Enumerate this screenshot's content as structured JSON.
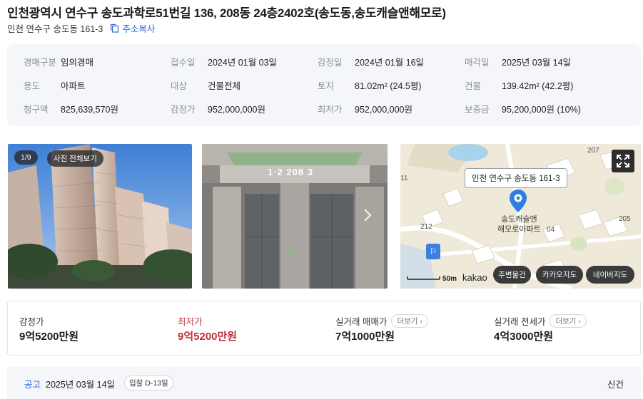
{
  "header": {
    "title": "인천광역시 연수구 송도과학로51번길 136, 208동 24층2402호(송도동,송도캐슬앤해모로)",
    "jibun": "인천 연수구 송도동 161-3",
    "copy_label": "주소복사"
  },
  "info": {
    "rows": [
      [
        {
          "k": "경매구분",
          "v": "임의경매"
        },
        {
          "k": "접수일",
          "v": "2024년 01월 03일"
        },
        {
          "k": "감정일",
          "v": "2024년 01월 16일"
        },
        {
          "k": "매각일",
          "v": "2025년 03월 14일"
        }
      ],
      [
        {
          "k": "용도",
          "v": "아파트"
        },
        {
          "k": "대상",
          "v": "건물전체"
        },
        {
          "k": "토지",
          "v": "81.02m² (24.5평)"
        },
        {
          "k": "건물",
          "v": "139.42m² (42.2평)"
        }
      ],
      [
        {
          "k": "청구액",
          "v": "825,639,570원"
        },
        {
          "k": "감정가",
          "v": "952,000,000원"
        },
        {
          "k": "최저가",
          "v": "952,000,000원"
        },
        {
          "k": "보증금",
          "v": "95,200,000원 (10%)"
        }
      ]
    ]
  },
  "gallery": {
    "counter": "1/9",
    "view_all": "사진 전체보기",
    "sign_text": "1·2  208  3"
  },
  "map": {
    "address_tooltip": "인천 연수구 송도동 161-3",
    "apt_name_line1": "송도캐슬앤",
    "apt_name_line2": "해모로아파트",
    "scale_label": "50m",
    "brand": "kakao",
    "bldg_labels": [
      "207",
      "205",
      "212",
      "11",
      "04"
    ],
    "buttons": {
      "nearby": "주변물건",
      "kakao": "카카오지도",
      "naver": "네이버지도"
    }
  },
  "prices": [
    {
      "label": "감정가",
      "value": "9억5200만원",
      "highlight": false,
      "more": ""
    },
    {
      "label": "최저가",
      "value": "9억5200만원",
      "highlight": true,
      "more": ""
    },
    {
      "label": "실거래 매매가",
      "value": "7억1000만원",
      "highlight": false,
      "more": "더보기"
    },
    {
      "label": "실거래 전세가",
      "value": "4억3000만원",
      "highlight": false,
      "more": "더보기"
    }
  ],
  "notice": {
    "label": "공고",
    "date": "2025년 03월 14일",
    "dday": "입찰 D-13일",
    "status": "신건"
  },
  "colors": {
    "accent": "#2f66d8",
    "lowest_price": "#c0313b",
    "marker": "#2f7de1"
  }
}
